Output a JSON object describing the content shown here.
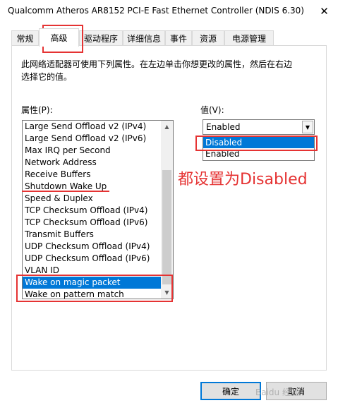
{
  "window": {
    "title": "Qualcomm Atheros AR8152 PCI-E Fast Ethernet Controller (NDIS 6.30)",
    "close_glyph": "✕"
  },
  "tabs": [
    {
      "label": "常规"
    },
    {
      "label": "高级"
    },
    {
      "label": "驱动程序"
    },
    {
      "label": "详细信息"
    },
    {
      "label": "事件"
    },
    {
      "label": "资源"
    },
    {
      "label": "电源管理"
    }
  ],
  "active_tab": "高级",
  "description": "此网络适配器可使用下列属性。在左边单击你想更改的属性，然后在右边选择它的值。",
  "property": {
    "label": "属性(P):",
    "items": [
      "Large Send Offload v2 (IPv4)",
      "Large Send Offload v2 (IPv6)",
      "Max IRQ per Second",
      "Network Address",
      "Receive Buffers",
      "Shutdown Wake Up",
      "Speed & Duplex",
      "TCP Checksum Offload (IPv4)",
      "TCP Checksum Offload (IPv6)",
      "Transmit Buffers",
      "UDP Checksum Offload (IPv4)",
      "UDP Checksum Offload (IPv6)",
      "VLAN ID",
      "Wake on magic packet",
      "Wake on pattern match"
    ],
    "selected": "Wake on magic packet"
  },
  "value": {
    "label": "值(V):",
    "current": "Enabled",
    "options": [
      "Disabled",
      "Enabled"
    ],
    "highlighted": "Disabled"
  },
  "annotation": {
    "text": "都设置为Disabled",
    "color": "#e53333"
  },
  "buttons": {
    "ok": "确定",
    "cancel": "取消"
  },
  "watermark": "Baidu 经验",
  "colors": {
    "selection": "#0078d7",
    "annotation_red": "#e53333"
  }
}
